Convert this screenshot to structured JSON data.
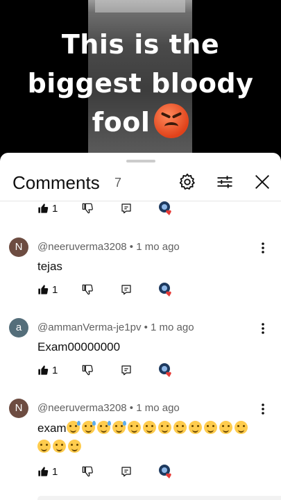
{
  "video": {
    "caption_line1": "This is the",
    "caption_line2": "biggest bloody",
    "caption_line3": "fool"
  },
  "sheet": {
    "title": "Comments",
    "count": "7"
  },
  "first_row": {
    "likes": "1"
  },
  "comments": [
    {
      "avatar_letter": "N",
      "avatar_color": "#6d4c41",
      "meta": "@neeruverma3208 • 1 mo ago",
      "text": "tejas",
      "likes": "1"
    },
    {
      "avatar_letter": "a",
      "avatar_color": "#546e7a",
      "meta": "@ammanVerma-je1pv • 1 mo ago",
      "text": "Exam00000000",
      "likes": "1"
    },
    {
      "avatar_letter": "N",
      "avatar_color": "#6d4c41",
      "meta": "@neeruverma3208 • 1 mo ago",
      "text": "exam",
      "likes": "1"
    }
  ],
  "colors": {
    "accent": "#0f0f0f",
    "heart": "#e53935"
  }
}
